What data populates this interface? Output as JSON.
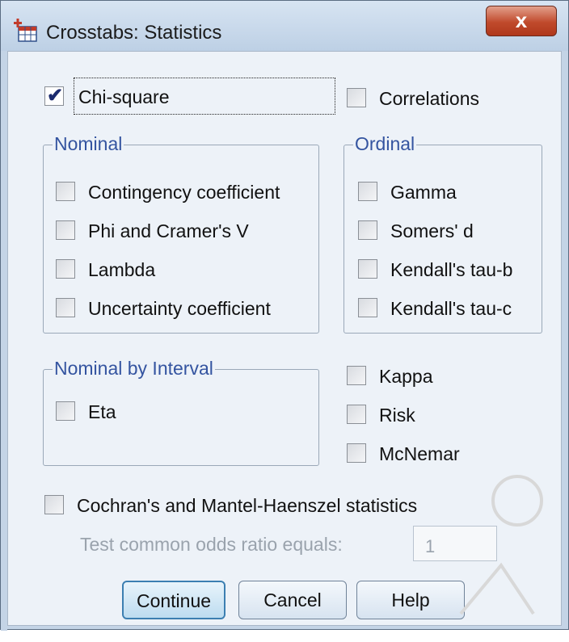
{
  "window": {
    "title": "Crosstabs: Statistics",
    "close_label": "x"
  },
  "top": {
    "chi_square": "Chi-square",
    "correlations": "Correlations"
  },
  "nominal": {
    "title": "Nominal",
    "items": [
      "Contingency coefficient",
      "Phi and Cramer's V",
      "Lambda",
      "Uncertainty coefficient"
    ]
  },
  "ordinal": {
    "title": "Ordinal",
    "items": [
      "Gamma",
      "Somers' d",
      "Kendall's tau-b",
      "Kendall's tau-c"
    ]
  },
  "nominal_by_interval": {
    "title": "Nominal by Interval",
    "eta": "Eta"
  },
  "other": {
    "kappa": "Kappa",
    "risk": "Risk",
    "mcnemar": "McNemar"
  },
  "cmh": {
    "label": "Cochran's and Mantel-Haenszel statistics",
    "odds_label": "Test common odds ratio equals:",
    "odds_value": "1"
  },
  "buttons": {
    "continue": "Continue",
    "cancel": "Cancel",
    "help": "Help"
  },
  "checked": {
    "chi_square": true
  }
}
